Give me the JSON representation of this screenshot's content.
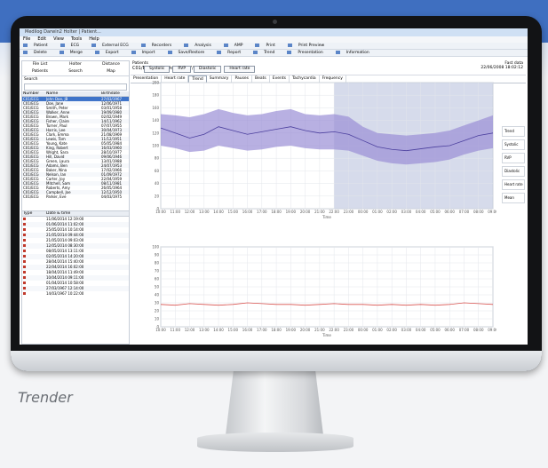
{
  "caption": "Trender",
  "app": {
    "title": "Medilog Darwin2 Holter | Patient...",
    "menu": [
      "File",
      "Edit",
      "View",
      "Tools",
      "Help"
    ],
    "toolbar1": [
      "Patient",
      "ECG",
      "External ECG",
      "Recorders",
      "Analysis",
      "AMP",
      "Print",
      "Print Preview"
    ],
    "toolbar2": [
      "Delete",
      "Merge",
      "Export",
      "Import",
      "Save/Restore",
      "Report",
      "Trend",
      "Presentation",
      "Information"
    ]
  },
  "left_panel": {
    "tabs": [
      "File List",
      "Holter",
      "Distance",
      "Patients",
      "Search",
      "Map"
    ],
    "search_label": "Search",
    "columns": [
      "Number",
      "Name",
      "Birthdate"
    ],
    "patients": [
      {
        "num": "C01/ECG",
        "name": "John Doe, JB",
        "birth": "27/03/1967"
      },
      {
        "num": "C01/ECG",
        "name": "Doe, Jane",
        "birth": "12/06/1971"
      },
      {
        "num": "C01/ECG",
        "name": "Smith, Peter",
        "birth": "03/01/1958"
      },
      {
        "num": "C01/ECG",
        "name": "Walker, Anne",
        "birth": "19/09/1980"
      },
      {
        "num": "C01/ECG",
        "name": "Brown, Mark",
        "birth": "02/02/1949"
      },
      {
        "num": "C01/ECG",
        "name": "Fisher, Claire",
        "birth": "14/11/1962"
      },
      {
        "num": "C01/ECG",
        "name": "Turner, Paul",
        "birth": "07/07/1955"
      },
      {
        "num": "C01/ECG",
        "name": "Harris, Lee",
        "birth": "30/04/1973"
      },
      {
        "num": "C01/ECG",
        "name": "Clark, Emma",
        "birth": "21/08/1969"
      },
      {
        "num": "C01/ECG",
        "name": "Lewis, Tom",
        "birth": "11/12/1951"
      },
      {
        "num": "C01/ECG",
        "name": "Young, Kate",
        "birth": "05/05/1984"
      },
      {
        "num": "C01/ECG",
        "name": "King, Robert",
        "birth": "16/03/1960"
      },
      {
        "num": "C01/ECG",
        "name": "Wright, Sara",
        "birth": "28/10/1977"
      },
      {
        "num": "C01/ECG",
        "name": "Hill, David",
        "birth": "09/06/1946"
      },
      {
        "num": "C01/ECG",
        "name": "Green, Laura",
        "birth": "13/01/1988"
      },
      {
        "num": "C01/ECG",
        "name": "Adams, Ben",
        "birth": "24/07/1953"
      },
      {
        "num": "C01/ECG",
        "name": "Baker, Nina",
        "birth": "17/02/1966"
      },
      {
        "num": "C01/ECG",
        "name": "Nelson, Ian",
        "birth": "01/09/1972"
      },
      {
        "num": "C01/ECG",
        "name": "Carter, Joy",
        "birth": "22/04/1959"
      },
      {
        "num": "C01/ECG",
        "name": "Mitchell, Sam",
        "birth": "08/11/1981"
      },
      {
        "num": "C01/ECG",
        "name": "Roberts, Amy",
        "birth": "26/05/1964"
      },
      {
        "num": "C01/ECG",
        "name": "Campbell, Joe",
        "birth": "12/12/1950"
      },
      {
        "num": "C01/ECG",
        "name": "Parker, Eve",
        "birth": "04/03/1975"
      }
    ],
    "date_header": [
      "Type",
      "Date & time"
    ],
    "dates": [
      "11/06/2014 12:19:00",
      "01/06/2014 11:02:00",
      "25/05/2014 10:14:00",
      "21/05/2014 09:44:00",
      "21/05/2014 09:03:00",
      "12/05/2014 08:30:00",
      "08/05/2014 13:11:00",
      "02/05/2014 14:20:00",
      "28/04/2014 15:40:00",
      "22/04/2014 16:02:00",
      "18/04/2014 11:49:00",
      "10/04/2014 09:11:00",
      "01/04/2014 10:58:00",
      "27/03/1967 12:14:00",
      "14/03/1967 10:22:00"
    ]
  },
  "main": {
    "patient_label": "Patients",
    "patient_name": "C01/ECG - John Doe, JB, 27/03/1967",
    "right_top": "Fast data",
    "right_date": "22/06/2008 18:02:12",
    "tabs": [
      "Presentation",
      "Heart rate",
      "Trend",
      "Summary",
      "Pauses",
      "Beats",
      "Events",
      "Tachycardia",
      "Frequency"
    ],
    "active_tab": "Trend",
    "toggles": [
      "Systolic",
      "RVP",
      "Diastolic",
      "Heart rate"
    ],
    "side_buttons": [
      "Trend",
      "Systolic",
      "RVP",
      "Diastolic",
      "Heart rate",
      "Mean"
    ]
  },
  "chart_data": [
    {
      "type": "area",
      "title": "",
      "xlabel": "Time",
      "ylabel": "",
      "x": [
        "10:00",
        "11:00",
        "12:00",
        "13:00",
        "14:00",
        "15:00",
        "16:00",
        "17:00",
        "18:00",
        "19:00",
        "20:00",
        "21:00",
        "22:00",
        "23:00",
        "00:00",
        "01:00",
        "02:00",
        "03:00",
        "04:00",
        "05:00",
        "06:00",
        "07:00",
        "08:00",
        "09:00"
      ],
      "ylim": [
        0,
        200
      ],
      "series": [
        {
          "values": [
            128,
            120,
            112,
            118,
            130,
            124,
            118,
            122,
            126,
            130,
            124,
            120,
            122,
            118,
            108,
            98,
            94,
            92,
            95,
            98,
            100,
            108,
            116,
            120
          ]
        },
        {
          "values": [
            150,
            148,
            145,
            150,
            158,
            152,
            148,
            150,
            155,
            158,
            150,
            148,
            150,
            146,
            130,
            120,
            118,
            116,
            118,
            120,
            124,
            132,
            140,
            148
          ]
        },
        {
          "values": [
            100,
            96,
            90,
            92,
            100,
            96,
            92,
            94,
            98,
            100,
            96,
            94,
            94,
            92,
            84,
            76,
            72,
            70,
            72,
            74,
            78,
            86,
            92,
            96
          ]
        }
      ],
      "highlight": {
        "from": "22:00",
        "to": "09:00"
      },
      "colors": {
        "band": "#9a8fd6",
        "line": "#4b3f9e",
        "highlight": "#aeb8d8"
      }
    },
    {
      "type": "line",
      "title": "",
      "xlabel": "Time",
      "ylabel": "",
      "x": [
        "10:00",
        "11:00",
        "12:00",
        "13:00",
        "14:00",
        "15:00",
        "16:00",
        "17:00",
        "18:00",
        "19:00",
        "20:00",
        "21:00",
        "22:00",
        "23:00",
        "00:00",
        "01:00",
        "02:00",
        "03:00",
        "04:00",
        "05:00",
        "06:00",
        "07:00",
        "08:00",
        "09:00"
      ],
      "ylim": [
        0,
        100
      ],
      "series": [
        {
          "values": [
            28,
            27,
            29,
            28,
            27,
            28,
            30,
            29,
            28,
            28,
            27,
            28,
            29,
            28,
            28,
            27,
            28,
            27,
            28,
            27,
            28,
            30,
            29,
            28
          ]
        }
      ],
      "colors": {
        "line": "#d9534f"
      }
    }
  ]
}
